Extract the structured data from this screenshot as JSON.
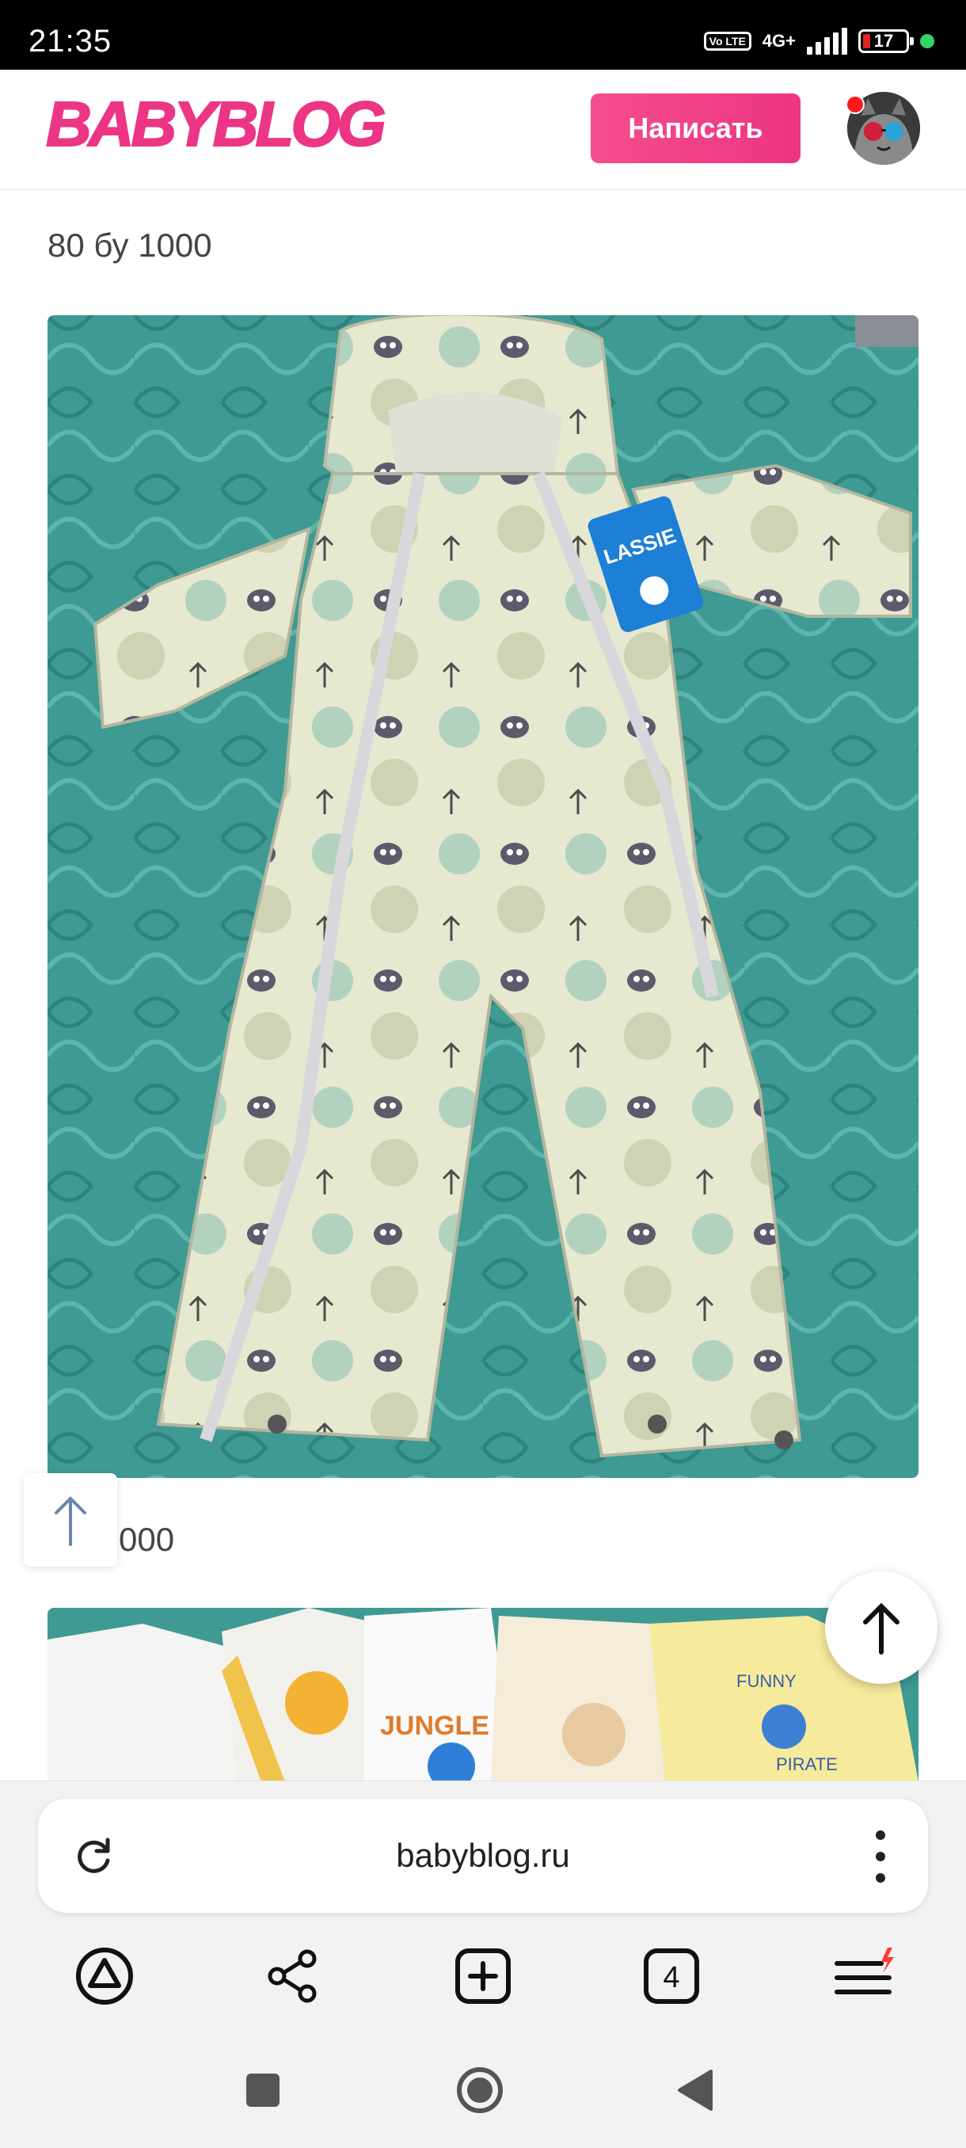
{
  "status_bar": {
    "time": "21:35",
    "volte": "Vo LTE",
    "network": "4G+",
    "battery": "17",
    "icons": [
      "volte-icon",
      "signal-icon",
      "battery-icon",
      "dot-icon"
    ]
  },
  "header": {
    "logo": "BABYBLOG",
    "write_button": "Написать",
    "avatar": "avatar-cat",
    "brand_color": "#ec3584"
  },
  "content": {
    "items": [
      {
        "caption": "80 бу 1000",
        "image": "baby-snowsuit-photo"
      },
      {
        "caption": "000",
        "image": "baby-clothes-photo"
      }
    ]
  },
  "browser": {
    "url": "babyblog.ru",
    "tabs_count": "4",
    "toolbar": [
      "alice-icon",
      "share-icon",
      "new-tab-icon",
      "tabs-icon",
      "menu-icon"
    ]
  },
  "system_nav": [
    "recents-icon",
    "home-icon",
    "back-icon"
  ]
}
